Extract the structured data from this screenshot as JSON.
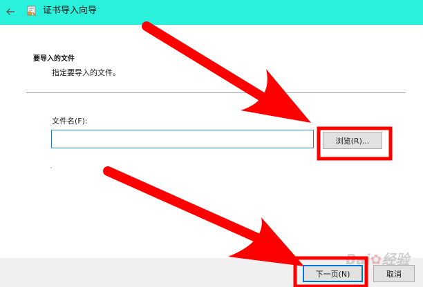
{
  "window": {
    "title": "证书导入向导",
    "back_icon": "arrow-left-icon",
    "app_icon": "certificate-icon"
  },
  "header": {
    "title": "要导入的文件",
    "description": "指定要导入的文件。"
  },
  "form": {
    "file_label": "文件名(F):",
    "file_value": "",
    "browse_label": "浏览(R)..."
  },
  "footer": {
    "next_label": "下一页(N)",
    "cancel_label": "取消"
  },
  "colors": {
    "titlebar": "#2af1dc",
    "annotation": "#ff0000",
    "input_border": "#2b7bd0"
  }
}
